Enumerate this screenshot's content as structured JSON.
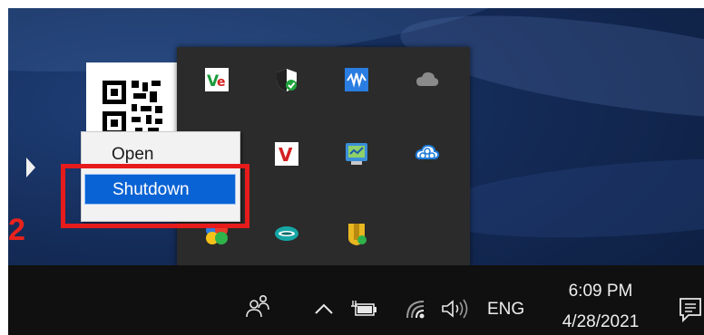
{
  "context_menu": {
    "open_label": "Open",
    "shutdown_label": "Shutdown"
  },
  "annotation": {
    "step_number": "2"
  },
  "taskbar": {
    "language": "ENG",
    "time": "6:09 PM",
    "date": "4/28/2021"
  },
  "tray_icons": [
    "vnc-icon",
    "security-shield-icon",
    "audio-wave-app-icon",
    "cloud-icon",
    "vietkey-v-icon",
    "network-monitor-icon",
    "cloud-network-icon",
    "colorful-app-icon",
    "viettel-icon",
    "shield-document-icon"
  ],
  "colors": {
    "highlight": "#e61b1b",
    "menu_selected": "#0a63d4",
    "tray_bg": "#2b2b2b",
    "taskbar_bg": "#101010"
  }
}
